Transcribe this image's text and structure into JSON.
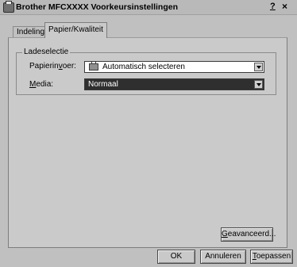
{
  "window": {
    "title": "Brother MFCXXXX Voorkeursinstellingen",
    "help_label": "?",
    "close_label": "×"
  },
  "tabs": [
    {
      "label": "Indeling",
      "active": false
    },
    {
      "label": "Papier/Kwaliteit",
      "active": true
    }
  ],
  "group": {
    "legend": "Ladeselectie",
    "paper_source": {
      "label_pre": "Papierin",
      "label_accel": "v",
      "label_post": "oer:",
      "value": "Automatisch selecteren"
    },
    "media": {
      "label_accel": "M",
      "label_post": "edia:",
      "value": "Normaal"
    }
  },
  "buttons": {
    "advanced": {
      "accel": "G",
      "rest": "eavanceerd..."
    },
    "ok": "OK",
    "cancel": "Annuleren",
    "apply": {
      "accel": "T",
      "rest": "oepassen"
    }
  }
}
